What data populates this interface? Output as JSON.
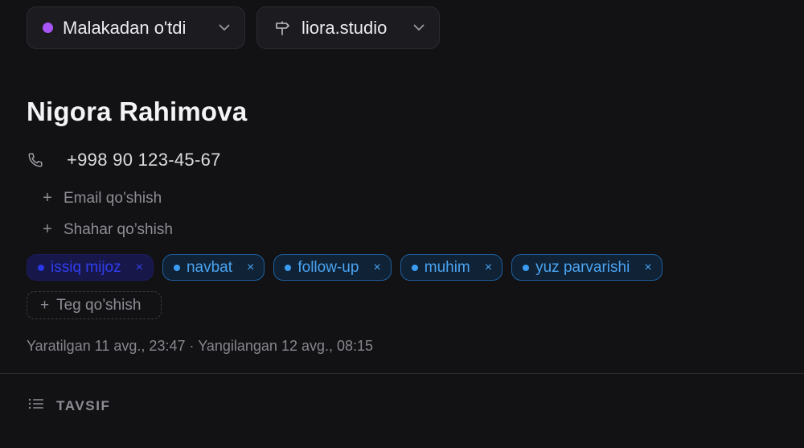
{
  "header": {
    "status": {
      "label": "Malakadan o'tdi",
      "dot_color": "#a855f7"
    },
    "site": {
      "label": "liora.studio"
    }
  },
  "contact": {
    "name": "Nigora Rahimova",
    "phone": "+998 90 123-45-67",
    "add_email": "Email qo’shish",
    "add_city": "Shahar qo’shish"
  },
  "tags": [
    {
      "label": "issiq mijoz",
      "remove": "×"
    },
    {
      "label": "navbat",
      "remove": "×"
    },
    {
      "label": "follow-up",
      "remove": "×"
    },
    {
      "label": "muhim",
      "remove": "×"
    },
    {
      "label": "yuz parvarishi",
      "remove": "×"
    }
  ],
  "add_tag": "Teg qo’shish",
  "meta": {
    "created": "Yaratilgan 11 avg., 23:47",
    "separator": "·",
    "updated": "Yangilangan 12 avg., 08:15"
  },
  "section": {
    "title": "TAVSIF"
  },
  "icons": {
    "status_dot": "status-dot-icon",
    "chevron": "chevron-down-icon",
    "signpost": "signpost-icon",
    "phone": "phone-icon",
    "plus": "plus-icon",
    "remove": "close-icon",
    "list": "list-icon"
  },
  "colors": {
    "background": "#121214",
    "tag_border": "#1f5f9e",
    "tag_text": "#4aa3f0",
    "tag_selected_bg": "#18174a"
  }
}
